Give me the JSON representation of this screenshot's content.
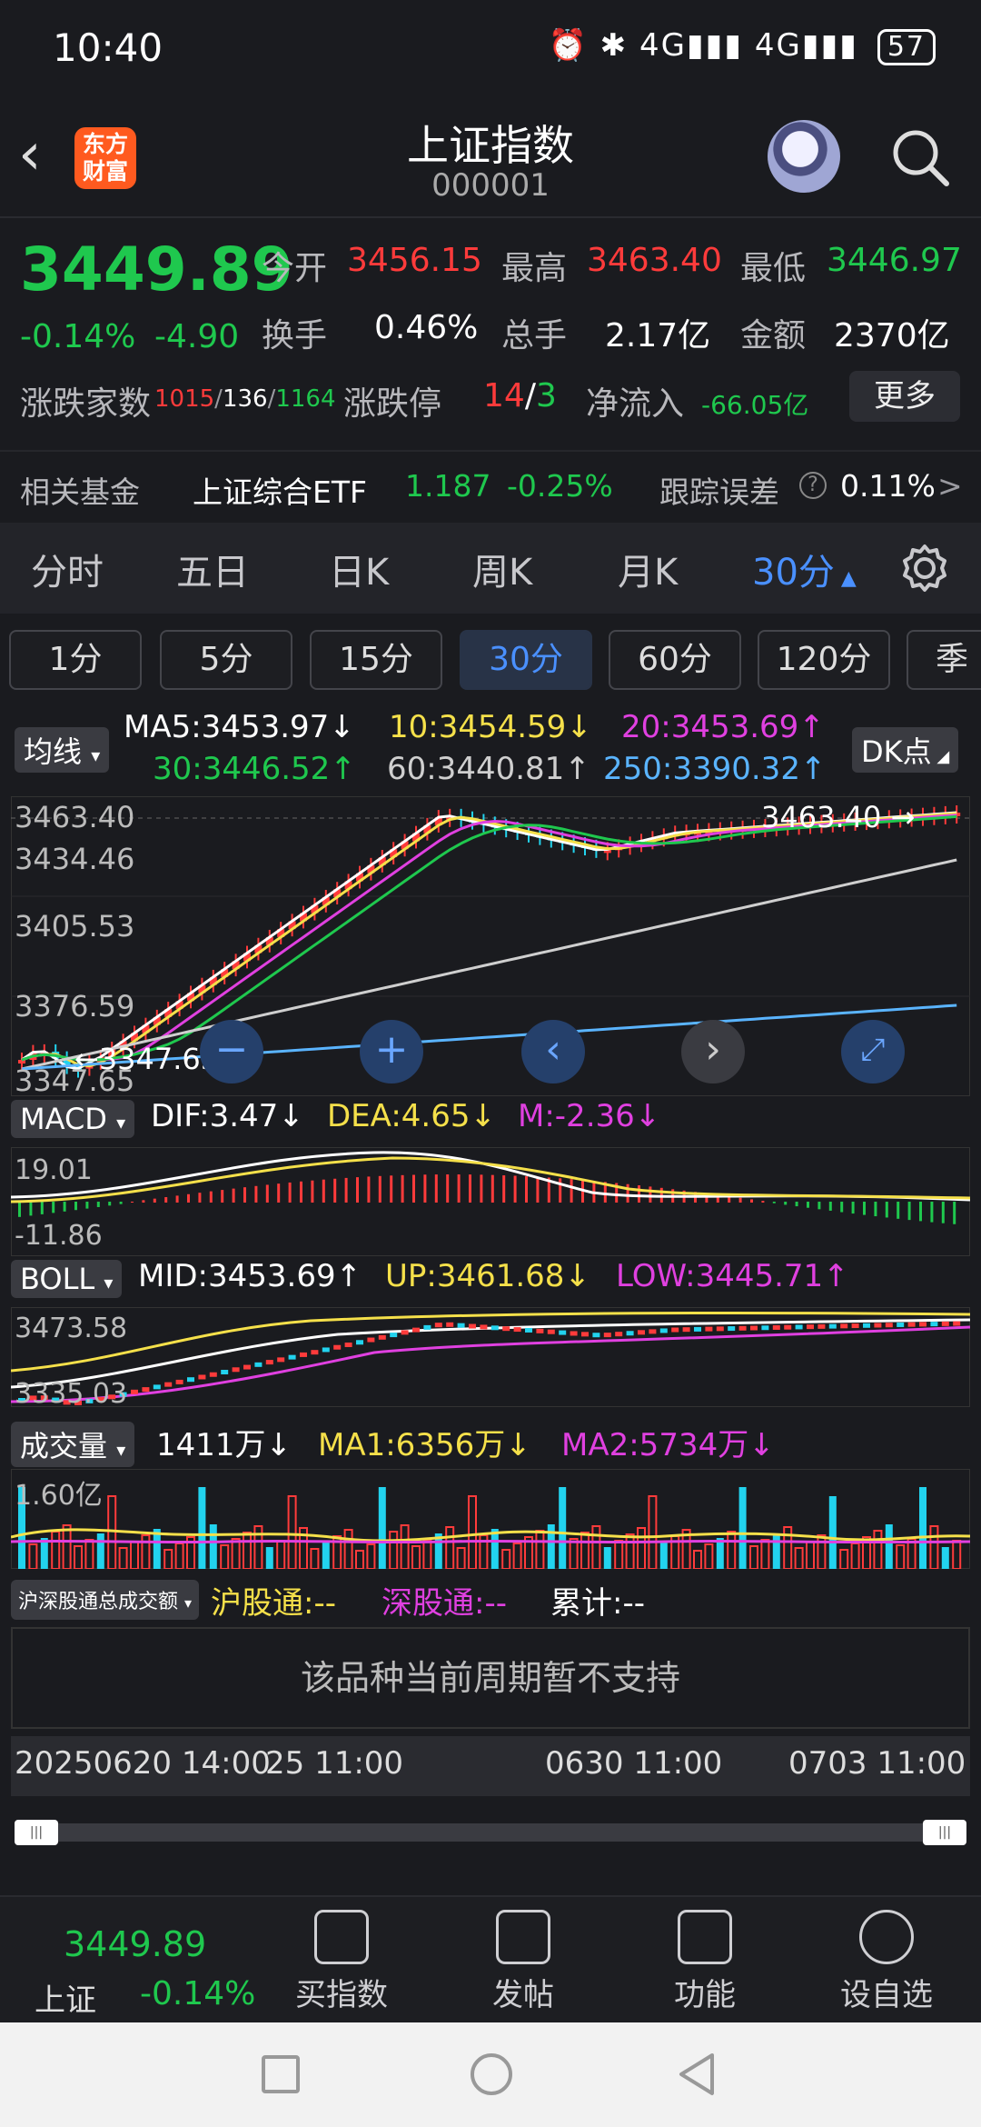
{
  "status_bar": {
    "time": "10:40",
    "icons": "⏰ ✱ 4G▮▮▮ 4G▮▮▮",
    "battery": "57"
  },
  "header": {
    "back_icon": "chevron-left-icon",
    "logo_text_top": "东方",
    "logo_text_bottom": "财富",
    "title": "上证指数",
    "code": "000001",
    "robot_icon": "robot-avatar-icon",
    "search_icon": "search-icon"
  },
  "quote": {
    "price": "3449.89",
    "change_pct": "-0.14%",
    "change": "-4.90",
    "open_label": "今开",
    "open": "3456.15",
    "high_label": "最高",
    "high": "3463.40",
    "low_label": "最低",
    "low": "3446.97",
    "turnover_label": "换手",
    "turnover": "0.46%",
    "volume_label": "总手",
    "volume": "2.17亿",
    "amount_label": "金额",
    "amount": "2370亿",
    "breadth_label": "涨跌家数",
    "breadth_up": "1015",
    "breadth_flat": "136",
    "breadth_down": "1164",
    "limit_label": "涨跌停",
    "limit_up": "14",
    "limit_sep": "/",
    "limit_down": "3",
    "netflow_label": "净流入",
    "netflow": "-66.05亿",
    "more_label": "更多"
  },
  "fund": {
    "label": "相关基金",
    "name": "上证综合ETF",
    "price": "1.187",
    "change": "-0.25%",
    "err_label": "跟踪误差",
    "err_value": "0.11%",
    "err_arrow": ">"
  },
  "period_tabs": [
    "分时",
    "五日",
    "日K",
    "周K",
    "月K",
    "30分"
  ],
  "period_active_index": 5,
  "minute_tabs": [
    "1分",
    "5分",
    "15分",
    "30分",
    "60分",
    "120分",
    "季"
  ],
  "minute_active_index": 3,
  "ma": {
    "label": "均线",
    "ma5": "MA5:3453.97↓",
    "ma10": "10:3454.59↓",
    "ma20": "20:3453.69↑",
    "ma30": "30:3446.52↑",
    "ma60": "60:3440.81↑",
    "ma250": "250:3390.32↑",
    "dk": "DK点"
  },
  "price_axis": [
    "3463.40",
    "3434.46",
    "3405.53",
    "3376.59",
    "3347.65"
  ],
  "chart_annotations": {
    "high": "3463.40 →",
    "low": "←3347.65"
  },
  "macd": {
    "label": "MACD",
    "dif": "DIF:3.47↓",
    "dea": "DEA:4.65↓",
    "m": "M:-2.36↓",
    "axis_top": "19.01",
    "axis_bottom": "-11.86"
  },
  "boll": {
    "label": "BOLL",
    "mid": "MID:3453.69↑",
    "up": "UP:3461.68↓",
    "low": "LOW:3445.71↑",
    "axis_top": "3473.58",
    "axis_bottom": "3335.03"
  },
  "vol": {
    "label": "成交量",
    "vol": "1411万↓",
    "ma1": "MA1:6356万↓",
    "ma2": "MA2:5734万↓",
    "axis_top": "1.60亿"
  },
  "hk": {
    "label": "沪深股通总成交额",
    "sh": "沪股通:--",
    "sz": "深股通:--",
    "total": "累计:--",
    "note": "该品种当前周期暂不支持"
  },
  "time_axis": [
    "20250620 14:00",
    "25 11:00",
    "0630 11:00",
    "0703 11:00"
  ],
  "colors": {
    "up": "#ff3b3b",
    "down": "#1fc84e",
    "ma5": "#ffffff",
    "ma10": "#f5e04a",
    "ma20": "#e040e0",
    "ma30": "#1fc84e",
    "ma60": "#cfcfcf",
    "ma250": "#5ab4ff",
    "accent": "#4a90ff"
  },
  "bottom_nav": {
    "price": "3449.89",
    "name": "上证",
    "pct": "-0.14%",
    "items": [
      "买指数",
      "发帖",
      "功能",
      "设自选"
    ]
  }
}
